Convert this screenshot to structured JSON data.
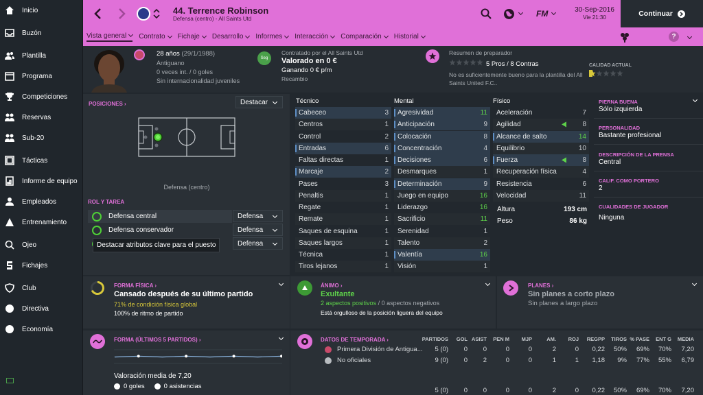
{
  "sidebar": {
    "items": [
      {
        "label": "Inicio",
        "icon": "home-icon"
      },
      {
        "label": "Buzón",
        "icon": "inbox-icon"
      },
      {
        "label": "Plantilla",
        "icon": "squad-icon"
      },
      {
        "label": "Programa",
        "icon": "schedule-icon"
      },
      {
        "label": "Competiciones",
        "icon": "trophy-icon"
      },
      {
        "label": "Reservas",
        "icon": "reserves-icon"
      },
      {
        "label": "Sub-20",
        "icon": "u20-icon"
      },
      {
        "label": "Tácticas",
        "icon": "tactics-icon"
      },
      {
        "label": "Informe de equipo",
        "icon": "report-icon"
      },
      {
        "label": "Empleados",
        "icon": "staff-icon"
      },
      {
        "label": "Entrenamiento",
        "icon": "training-icon"
      },
      {
        "label": "Ojeo",
        "icon": "scouting-icon"
      },
      {
        "label": "Fichajes",
        "icon": "transfers-icon"
      },
      {
        "label": "Club",
        "icon": "club-icon"
      },
      {
        "label": "Directiva",
        "icon": "board-icon"
      },
      {
        "label": "Economía",
        "icon": "finance-icon"
      }
    ]
  },
  "header": {
    "player_name": "44. Terrence Robinson",
    "subtitle": "Defensa (centro) - All Saints Utd",
    "date": "30-Sep-2016",
    "time": "Vie 21:30",
    "continue_label": "Continuar",
    "fm_label": "FM"
  },
  "nav": [
    "Vista general",
    "Contrato",
    "Fichaje",
    "Desarrollo",
    "Informes",
    "Interacción",
    "Comparación",
    "Historial"
  ],
  "profile": {
    "age": "28 años",
    "dob": "(29/1/1988)",
    "nationality": "Antiguano",
    "caps": "0 veces int. / 0 goles",
    "youth": "Sin internacionalidad juveniles",
    "contract_by": "Contratado por el All Saints Utd",
    "value": "Valorado en 0 €",
    "wage": "Ganando 0 € p/m",
    "squad_status": "Recambio",
    "contract_badge": "Seg",
    "coach_summary_label": "Resumen de preparador",
    "pros_cons": "5 Pros / 8 Contras",
    "coach_note": "No es suficientemente bueno para la plantilla del All Saints United F.C..",
    "current_ability_label": "CALIDAD ACTUAL",
    "coach_stars": 0,
    "ability_stars": 0.5
  },
  "positions": {
    "label": "POSICIONES",
    "highlight_dropdown": "Destacar",
    "position_caption": "Defensa (centro)",
    "role_label": "ROL Y TAREA",
    "roles": [
      {
        "name": "Defensa central",
        "duty": "Defensa"
      },
      {
        "name": "Defensa conservador",
        "duty": "Defensa"
      },
      {
        "name": "",
        "duty": "Defensa"
      }
    ],
    "tooltip": "Destacar atributos clave para el puesto"
  },
  "attributes": {
    "technical_title": "Técnico",
    "mental_title": "Mental",
    "physical_title": "Físico",
    "technical": [
      {
        "name": "Cabeceo",
        "value": "3",
        "hl": true
      },
      {
        "name": "Centros",
        "value": "1",
        "hl": false
      },
      {
        "name": "Control",
        "value": "2",
        "hl": false
      },
      {
        "name": "Entradas",
        "value": "6",
        "hl": true
      },
      {
        "name": "Faltas directas",
        "value": "1",
        "hl": false
      },
      {
        "name": "Marcaje",
        "value": "2",
        "hl": true
      },
      {
        "name": "Pases",
        "value": "3",
        "hl": false
      },
      {
        "name": "Penaltis",
        "value": "1",
        "hl": false
      },
      {
        "name": "Regate",
        "value": "1",
        "hl": false
      },
      {
        "name": "Remate",
        "value": "1",
        "hl": false
      },
      {
        "name": "Saques de esquina",
        "value": "1",
        "hl": false
      },
      {
        "name": "Saques largos",
        "value": "1",
        "hl": false
      },
      {
        "name": "Técnica",
        "value": "1",
        "hl": false
      },
      {
        "name": "Tiros lejanos",
        "value": "1",
        "hl": false
      }
    ],
    "mental": [
      {
        "name": "Agresividad",
        "value": "11",
        "hl": true,
        "g": true
      },
      {
        "name": "Anticipación",
        "value": "9",
        "hl": true
      },
      {
        "name": "Colocación",
        "value": "8",
        "hl": true
      },
      {
        "name": "Concentración",
        "value": "4",
        "hl": true
      },
      {
        "name": "Decisiones",
        "value": "6",
        "hl": true
      },
      {
        "name": "Desmarques",
        "value": "1",
        "hl": false
      },
      {
        "name": "Determinación",
        "value": "9",
        "hl": true
      },
      {
        "name": "Juego en equipo",
        "value": "16",
        "hl": false,
        "g": true
      },
      {
        "name": "Liderazgo",
        "value": "16",
        "hl": false,
        "g": true
      },
      {
        "name": "Sacrificio",
        "value": "11",
        "hl": false,
        "g": true
      },
      {
        "name": "Serenidad",
        "value": "1",
        "hl": false
      },
      {
        "name": "Talento",
        "value": "2",
        "hl": false
      },
      {
        "name": "Valentía",
        "value": "16",
        "hl": true,
        "g": true
      },
      {
        "name": "Visión",
        "value": "1",
        "hl": false
      }
    ],
    "physical": [
      {
        "name": "Aceleración",
        "value": "7",
        "hl": false
      },
      {
        "name": "Agilidad",
        "value": "8",
        "hl": false,
        "arrow": true
      },
      {
        "name": "Alcance de salto",
        "value": "14",
        "hl": true,
        "g": true
      },
      {
        "name": "Equilibrio",
        "value": "10",
        "hl": false
      },
      {
        "name": "Fuerza",
        "value": "8",
        "hl": true,
        "arrow": true
      },
      {
        "name": "Recuperación física",
        "value": "4",
        "hl": false
      },
      {
        "name": "Resistencia",
        "value": "6",
        "hl": false
      },
      {
        "name": "Velocidad",
        "value": "11",
        "hl": false
      }
    ],
    "height_label": "Altura",
    "height": "193 cm",
    "weight_label": "Peso",
    "weight": "86 kg"
  },
  "info": {
    "foot_label": "PIERNA BUENA",
    "foot": "Sólo izquierda",
    "personality_label": "PERSONALIDAD",
    "personality": "Bastante profesional",
    "press_label": "DESCRIPCIÓN DE LA PRENSA",
    "press": "Central",
    "gk_label": "CALIF. COMO PORTERO",
    "gk": "2",
    "qualities_label": "CUALIDADES DE JUGADOR",
    "qualities": "Ninguna"
  },
  "fitness": {
    "label": "FORMA FÍSICA",
    "headline": "Cansado después de su último partido",
    "condition": "71% de condición física global",
    "match_sharpness": "100% de ritmo de partido"
  },
  "morale": {
    "label": "ÁNIMO",
    "headline": "Exultante",
    "positives": "2 aspectos positivos",
    "negatives": "0 aspectos negativos",
    "note": "Está orgulloso de la posición liguera del equipo"
  },
  "plans": {
    "label": "PLANES",
    "headline": "Sin planes a corto plazo",
    "note": "Sin planes a largo plazo"
  },
  "form": {
    "label": "FORMA (ÚLTIMOS 5 PARTIDOS)",
    "avg": "Valoración media de 7,20",
    "goals": "0 goles",
    "assists": "0 asistencias",
    "ratings": [
      7.2,
      7.3,
      7.2,
      7.3,
      7.2,
      7.3,
      7.2,
      7.3
    ]
  },
  "season": {
    "label": "DATOS DE TEMPORADA",
    "headers": [
      "PARTIDOS",
      "GOL",
      "ASIST",
      "PEN M",
      "MJP",
      "AM.",
      "ROJ",
      "REGPP",
      "TIROS",
      "% PASE",
      "ENT G",
      "MEDIA"
    ],
    "rows": [
      {
        "comp": "Primera División de Antigua...",
        "vals": [
          "5 (0)",
          "0",
          "0",
          "0",
          "0",
          "2",
          "0",
          "0,22",
          "50%",
          "69%",
          "70%",
          "7,20"
        ]
      },
      {
        "comp": "No oficiales",
        "vals": [
          "9 (0)",
          "0",
          "2",
          "0",
          "0",
          "1",
          "1",
          "1,18",
          "9%",
          "77%",
          "55%",
          "6,79"
        ]
      },
      {
        "comp": "",
        "vals": [
          "5 (0)",
          "0",
          "0",
          "0",
          "0",
          "2",
          "0",
          "0,22",
          "50%",
          "69%",
          "70%",
          "7,20"
        ]
      }
    ]
  }
}
